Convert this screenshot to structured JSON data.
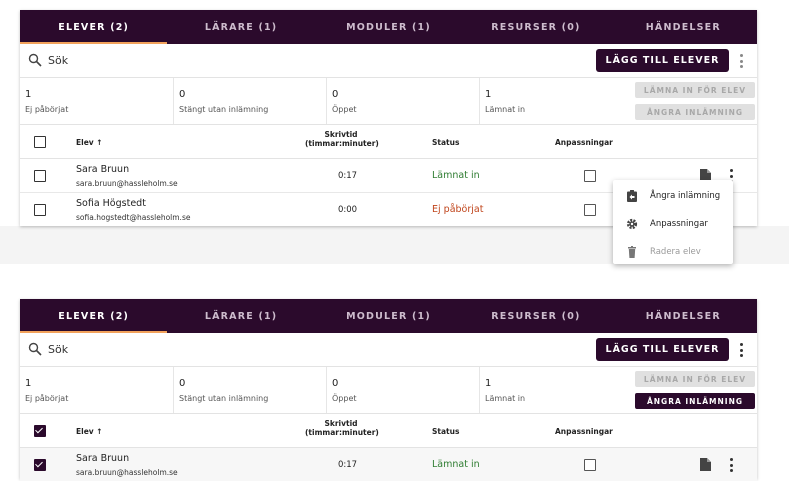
{
  "tabs": [
    {
      "label": "ELEVER (2)"
    },
    {
      "label": "LÄRARE (1)"
    },
    {
      "label": "MODULER (1)"
    },
    {
      "label": "RESURSER (0)"
    },
    {
      "label": "HÄNDELSER"
    }
  ],
  "toolbar": {
    "search_label": "Sök",
    "add_label": "LÄGG TILL ELEVER"
  },
  "stats": [
    {
      "value": "1",
      "label": "Ej påbörjat"
    },
    {
      "value": "0",
      "label": "Stängt utan inlämning"
    },
    {
      "value": "0",
      "label": "Öppet"
    },
    {
      "value": "1",
      "label": "Lämnat in"
    }
  ],
  "actions": {
    "submit_label": "LÄMNA IN FÖR ELEV",
    "undo_label": "ÅNGRA INLÄMNING"
  },
  "columns": {
    "student": "Elev",
    "time_line1": "Skrivtid",
    "time_line2": "(timmar:minuter)",
    "status": "Status",
    "adjustments": "Anpassningar"
  },
  "rows": [
    {
      "name": "Sara Bruun",
      "email": "sara.bruun@hassleholm.se",
      "time": "0:17",
      "status": "Lämnat in"
    },
    {
      "name": "Sofia Högstedt",
      "email": "sofia.hogstedt@hassleholm.se",
      "time": "0:00",
      "status": "Ej påbörjat"
    }
  ],
  "menu": [
    {
      "label": "Ångra inlämning",
      "icon": "undo-clipboard-icon"
    },
    {
      "label": "Anpassningar",
      "icon": "gear-icon"
    },
    {
      "label": "Radera elev",
      "icon": "trash-icon"
    }
  ],
  "colors": {
    "brand": "#2b0a2c",
    "tab_indicator": "#f2a25c",
    "status_submitted": "#2f7d32",
    "status_not_started": "#c0451c"
  }
}
